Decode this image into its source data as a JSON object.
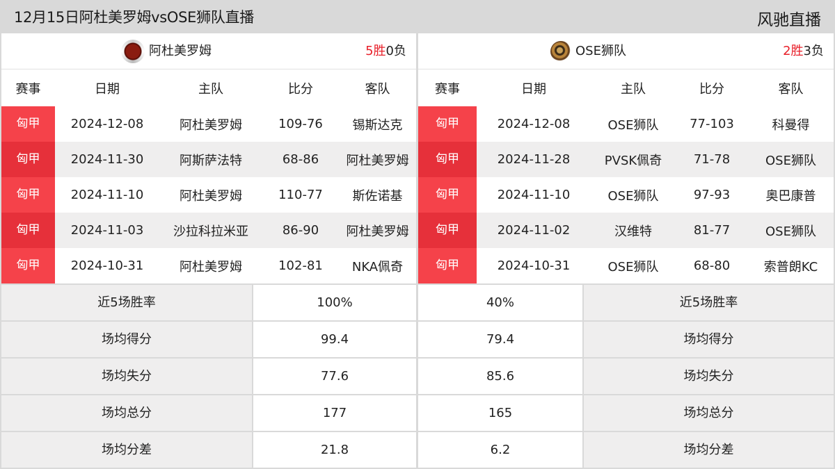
{
  "header": {
    "title": "12月15日阿杜美罗姆vsOSE狮队直播",
    "brand": "风驰直播"
  },
  "columns": [
    "赛事",
    "日期",
    "主队",
    "比分",
    "客队"
  ],
  "home_team": {
    "name": "阿杜美罗姆",
    "logo_icon": "team-logo-admira",
    "record": {
      "wins": "5",
      "win_label": "胜",
      "losses": "0",
      "loss_label": "负"
    },
    "matches": [
      {
        "league": "匈甲",
        "date": "2024-12-08",
        "home": "阿杜美罗姆",
        "score": "109-76",
        "away": "锡斯达克"
      },
      {
        "league": "匈甲",
        "date": "2024-11-30",
        "home": "阿斯萨法特",
        "score": "68-86",
        "away": "阿杜美罗姆"
      },
      {
        "league": "匈甲",
        "date": "2024-11-10",
        "home": "阿杜美罗姆",
        "score": "110-77",
        "away": "斯佐诺基"
      },
      {
        "league": "匈甲",
        "date": "2024-11-03",
        "home": "沙拉科拉米亚",
        "score": "86-90",
        "away": "阿杜美罗姆"
      },
      {
        "league": "匈甲",
        "date": "2024-10-31",
        "home": "阿杜美罗姆",
        "score": "102-81",
        "away": "NKA佩奇"
      }
    ]
  },
  "away_team": {
    "name": "OSE狮队",
    "logo_icon": "team-logo-ose",
    "record": {
      "wins": "2",
      "win_label": "胜",
      "losses": "3",
      "loss_label": "负"
    },
    "matches": [
      {
        "league": "匈甲",
        "date": "2024-12-08",
        "home": "OSE狮队",
        "score": "77-103",
        "away": "科曼得"
      },
      {
        "league": "匈甲",
        "date": "2024-11-28",
        "home": "PVSK佩奇",
        "score": "71-78",
        "away": "OSE狮队"
      },
      {
        "league": "匈甲",
        "date": "2024-11-10",
        "home": "OSE狮队",
        "score": "97-93",
        "away": "奥巴康普"
      },
      {
        "league": "匈甲",
        "date": "2024-11-02",
        "home": "汉维特",
        "score": "81-77",
        "away": "OSE狮队"
      },
      {
        "league": "匈甲",
        "date": "2024-10-31",
        "home": "OSE狮队",
        "score": "68-80",
        "away": "索普朗KC"
      }
    ]
  },
  "stats": [
    {
      "label": "近5场胜率",
      "home": "100%",
      "away": "40%"
    },
    {
      "label": "场均得分",
      "home": "99.4",
      "away": "79.4"
    },
    {
      "label": "场均失分",
      "home": "77.6",
      "away": "85.6"
    },
    {
      "label": "场均总分",
      "home": "177",
      "away": "165"
    },
    {
      "label": "场均分差",
      "home": "21.8",
      "away": "6.2"
    }
  ],
  "colors": {
    "badge": "#f5424a",
    "badge_alt": "#e6303a",
    "win": "#e8202a",
    "header_bg": "#d9d9d9",
    "row_alt": "#efeeee"
  }
}
